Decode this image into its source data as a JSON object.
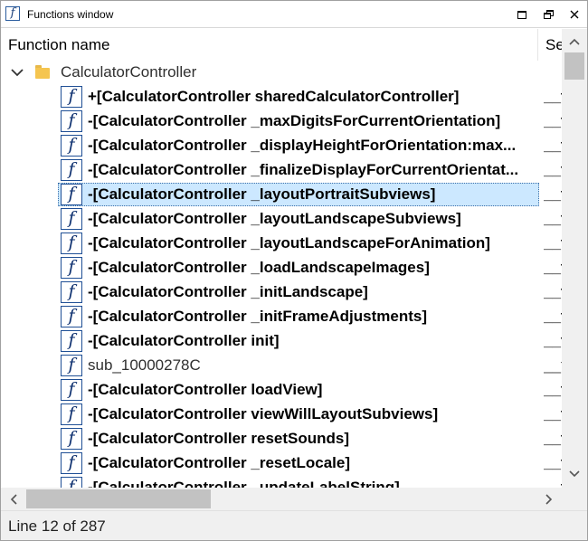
{
  "window": {
    "title": "Functions window",
    "icon": "function-icon",
    "buttons": [
      "minimize",
      "restore",
      "close"
    ]
  },
  "columns": {
    "name": "Function name",
    "segment": "Se"
  },
  "tree": {
    "root": {
      "label": "CalculatorController",
      "expanded": true,
      "icon": "folder-icon"
    },
    "items": [
      {
        "name": "+[CalculatorController sharedCalculatorController]",
        "segment": "__t",
        "bold": true
      },
      {
        "name": "-[CalculatorController _maxDigitsForCurrentOrientation]",
        "segment": "__t",
        "bold": true
      },
      {
        "name": "-[CalculatorController _displayHeightForOrientation:max...",
        "segment": "__t",
        "bold": true
      },
      {
        "name": "-[CalculatorController _finalizeDisplayForCurrentOrientat...",
        "segment": "__t",
        "bold": true
      },
      {
        "name": "-[CalculatorController _layoutPortraitSubviews]",
        "segment": "__t",
        "bold": true,
        "selected": true
      },
      {
        "name": "-[CalculatorController _layoutLandscapeSubviews]",
        "segment": "__t",
        "bold": true
      },
      {
        "name": "-[CalculatorController _layoutLandscapeForAnimation]",
        "segment": "__t",
        "bold": true
      },
      {
        "name": "-[CalculatorController _loadLandscapeImages]",
        "segment": "__t",
        "bold": true
      },
      {
        "name": "-[CalculatorController _initLandscape]",
        "segment": "__t",
        "bold": true
      },
      {
        "name": "-[CalculatorController _initFrameAdjustments]",
        "segment": "__t",
        "bold": true
      },
      {
        "name": "-[CalculatorController init]",
        "segment": "__t",
        "bold": true
      },
      {
        "name": "sub_10000278C",
        "segment": "__t",
        "bold": false
      },
      {
        "name": "-[CalculatorController loadView]",
        "segment": "__t",
        "bold": true
      },
      {
        "name": "-[CalculatorController viewWillLayoutSubviews]",
        "segment": "__t",
        "bold": true
      },
      {
        "name": "-[CalculatorController resetSounds]",
        "segment": "__t",
        "bold": true
      },
      {
        "name": "-[CalculatorController _resetLocale]",
        "segment": "__t",
        "bold": true
      },
      {
        "name": "-[CalculatorController _updateLabelString]",
        "segment": "__t",
        "bold": true
      }
    ]
  },
  "status": {
    "text": "Line 12 of 287"
  },
  "colors": {
    "selection": "#cce8ff",
    "icon_border": "#1f4f95",
    "folder": "#f5c54f",
    "scrollbar_track": "#f0f0f0",
    "scrollbar_thumb": "#c2c2c2"
  }
}
